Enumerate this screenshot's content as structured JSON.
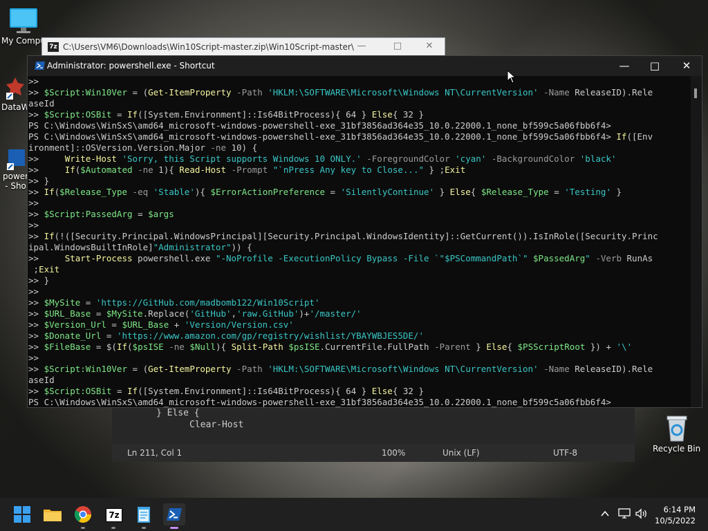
{
  "desktop": {
    "icons": [
      {
        "label": "My Compu",
        "icon": "computer-icon"
      },
      {
        "label": "DataW",
        "icon": "datawrapper-icon"
      },
      {
        "label": "power",
        "label2": "- Sho",
        "icon": "powershell-shortcut-icon"
      },
      {
        "label": "Recycle Bin",
        "icon": "recycle-bin-icon"
      }
    ]
  },
  "explorer_window": {
    "title": "C:\\Users\\VM6\\Downloads\\Win10Script-master.zip\\Win10Script-master\\"
  },
  "notepad": {
    "code_lines": [
      "} Else {",
      "Clear-Host"
    ],
    "status": {
      "position": "Ln 211, Col 1",
      "zoom": "100%",
      "line_ending": "Unix (LF)",
      "encoding": "UTF-8"
    }
  },
  "powershell": {
    "title": "Administrator: powershell.exe - Shortcut",
    "lines": [
      [
        [
          "p",
          ">>"
        ]
      ],
      [
        [
          "p",
          ">> "
        ],
        [
          "v",
          "$Script:Win10Ver"
        ],
        [
          "p",
          " = ("
        ],
        [
          "c",
          "Get-ItemProperty"
        ],
        [
          "m",
          " -Path "
        ],
        [
          "s",
          "'HKLM:\\SOFTWARE\\Microsoft\\Windows NT\\CurrentVersion'"
        ],
        [
          "m",
          " -Name "
        ],
        [
          "p",
          "ReleaseID).Rele"
        ]
      ],
      [
        [
          "p",
          "aseId"
        ]
      ],
      [
        [
          "p",
          ">> "
        ],
        [
          "v",
          "$Script:OSBit"
        ],
        [
          "p",
          " = "
        ],
        [
          "c",
          "If"
        ],
        [
          "p",
          "([System.Environment]::Is64BitProcess){ 64 } "
        ],
        [
          "c",
          "Else"
        ],
        [
          "p",
          "{ 32 }"
        ]
      ],
      [
        [
          "p",
          "PS C:\\Windows\\WinSxS\\amd64_microsoft-windows-powershell-exe_31bf3856ad364e35_10.0.22000.1_none_bf599c5a06fbb6f4>"
        ]
      ],
      [
        [
          "p",
          "PS C:\\Windows\\WinSxS\\amd64_microsoft-windows-powershell-exe_31bf3856ad364e35_10.0.22000.1_none_bf599c5a06fbb6f4> "
        ],
        [
          "c",
          "If"
        ],
        [
          "p",
          "([Env"
        ]
      ],
      [
        [
          "p",
          "ironment]::OSVersion.Version.Major "
        ],
        [
          "m",
          "-ne"
        ],
        [
          "p",
          " 10) {"
        ]
      ],
      [
        [
          "p",
          ">>     "
        ],
        [
          "c",
          "Write-Host"
        ],
        [
          "s",
          " 'Sorry, this Script supports Windows 10 ONLY.'"
        ],
        [
          "m",
          " -ForegroundColor "
        ],
        [
          "s",
          "'cyan'"
        ],
        [
          "m",
          " -BackgroundColor "
        ],
        [
          "s",
          "'black'"
        ]
      ],
      [
        [
          "p",
          ">>     "
        ],
        [
          "c",
          "If"
        ],
        [
          "p",
          "("
        ],
        [
          "v",
          "$Automated"
        ],
        [
          "m",
          " -ne"
        ],
        [
          "p",
          " 1){ "
        ],
        [
          "c",
          "Read-Host"
        ],
        [
          "m",
          " -Prompt "
        ],
        [
          "s",
          "\"`nPress Any key to Close...\""
        ],
        [
          "p",
          " } ;"
        ],
        [
          "c",
          "Exit"
        ]
      ],
      [
        [
          "p",
          ">> }"
        ]
      ],
      [
        [
          "p",
          ">> "
        ],
        [
          "c",
          "If"
        ],
        [
          "p",
          "("
        ],
        [
          "v",
          "$Release_Type"
        ],
        [
          "m",
          " -eq "
        ],
        [
          "s",
          "'Stable'"
        ],
        [
          "p",
          "){ "
        ],
        [
          "v",
          "$ErrorActionPreference"
        ],
        [
          "p",
          " = "
        ],
        [
          "s",
          "'SilentlyContinue'"
        ],
        [
          "p",
          " } "
        ],
        [
          "c",
          "Else"
        ],
        [
          "p",
          "{ "
        ],
        [
          "v",
          "$Release_Type"
        ],
        [
          "p",
          " = "
        ],
        [
          "s",
          "'Testing'"
        ],
        [
          "p",
          " }"
        ]
      ],
      [
        [
          "p",
          ">>"
        ]
      ],
      [
        [
          "p",
          ">> "
        ],
        [
          "v",
          "$Script:PassedArg"
        ],
        [
          "p",
          " = "
        ],
        [
          "v",
          "$args"
        ]
      ],
      [
        [
          "p",
          ">>"
        ]
      ],
      [
        [
          "p",
          ">> "
        ],
        [
          "c",
          "If"
        ],
        [
          "p",
          "(!([Security.Principal.WindowsPrincipal][Security.Principal.WindowsIdentity]::GetCurrent()).IsInRole([Security.Princ"
        ]
      ],
      [
        [
          "p",
          "ipal.WindowsBuiltInRole]"
        ],
        [
          "s",
          "\"Administrator\""
        ],
        [
          "p",
          ")) {"
        ]
      ],
      [
        [
          "p",
          ">>     "
        ],
        [
          "c",
          "Start-Process"
        ],
        [
          "p",
          " powershell.exe "
        ],
        [
          "s",
          "\"-NoProfile -ExecutionPolicy Bypass -File `\"$PSCommandPath`\" "
        ],
        [
          "v",
          "$PassedArg"
        ],
        [
          "s",
          "\""
        ],
        [
          "m",
          " -Verb "
        ],
        [
          "p",
          "RunAs"
        ]
      ],
      [
        [
          "p",
          " ;"
        ],
        [
          "c",
          "Exit"
        ]
      ],
      [
        [
          "p",
          ">> }"
        ]
      ],
      [
        [
          "p",
          ">>"
        ]
      ],
      [
        [
          "p",
          ">> "
        ],
        [
          "v",
          "$MySite"
        ],
        [
          "p",
          " = "
        ],
        [
          "s",
          "'https://GitHub.com/madbomb122/Win10Script'"
        ]
      ],
      [
        [
          "p",
          ">> "
        ],
        [
          "v",
          "$URL_Base"
        ],
        [
          "p",
          " = "
        ],
        [
          "v",
          "$MySite"
        ],
        [
          "p",
          ".Replace("
        ],
        [
          "s",
          "'GitHub'"
        ],
        [
          "p",
          ","
        ],
        [
          "s",
          "'raw.GitHub'"
        ],
        [
          "p",
          ")+"
        ],
        [
          "s",
          "'/master/'"
        ]
      ],
      [
        [
          "p",
          ">> "
        ],
        [
          "v",
          "$Version_Url"
        ],
        [
          "p",
          " = "
        ],
        [
          "v",
          "$URL_Base"
        ],
        [
          "p",
          " + "
        ],
        [
          "s",
          "'Version/Version.csv'"
        ]
      ],
      [
        [
          "p",
          ">> "
        ],
        [
          "v",
          "$Donate_Url"
        ],
        [
          "p",
          " = "
        ],
        [
          "s",
          "'https://www.amazon.com/gp/registry/wishlist/YBAYWBJES5DE/'"
        ]
      ],
      [
        [
          "p",
          ">> "
        ],
        [
          "v",
          "$FileBase"
        ],
        [
          "p",
          " = $("
        ],
        [
          "c",
          "If"
        ],
        [
          "p",
          "("
        ],
        [
          "v",
          "$psISE"
        ],
        [
          "m",
          " -ne "
        ],
        [
          "v",
          "$Null"
        ],
        [
          "p",
          "){ "
        ],
        [
          "c",
          "Split-Path"
        ],
        [
          "v",
          " $psISE"
        ],
        [
          "p",
          ".CurrentFile.FullPath"
        ],
        [
          "m",
          " -Parent"
        ],
        [
          "p",
          " } "
        ],
        [
          "c",
          "Else"
        ],
        [
          "p",
          "{ "
        ],
        [
          "v",
          "$PSScriptRoot"
        ],
        [
          "p",
          " }) + "
        ],
        [
          "s",
          "'\\'"
        ]
      ],
      [
        [
          "p",
          ">>"
        ]
      ],
      [
        [
          "p",
          ">> "
        ],
        [
          "v",
          "$Script:Win10Ver"
        ],
        [
          "p",
          " = ("
        ],
        [
          "c",
          "Get-ItemProperty"
        ],
        [
          "m",
          " -Path "
        ],
        [
          "s",
          "'HKLM:\\SOFTWARE\\Microsoft\\Windows NT\\CurrentVersion'"
        ],
        [
          "m",
          " -Name "
        ],
        [
          "p",
          "ReleaseID).Rele"
        ]
      ],
      [
        [
          "p",
          "aseId"
        ]
      ],
      [
        [
          "p",
          ">> "
        ],
        [
          "v",
          "$Script:OSBit"
        ],
        [
          "p",
          " = "
        ],
        [
          "c",
          "If"
        ],
        [
          "p",
          "([System.Environment]::Is64BitProcess){ 64 } "
        ],
        [
          "c",
          "Else"
        ],
        [
          "p",
          "{ 32 }"
        ]
      ],
      [
        [
          "p",
          "PS C:\\Windows\\WinSxS\\amd64_microsoft-windows-powershell-exe_31bf3856ad364e35_10.0.22000.1_none_bf599c5a06fbb6f4>"
        ]
      ]
    ]
  },
  "taskbar": {
    "apps": [
      {
        "name": "start-button",
        "icon": "windows-logo-icon"
      },
      {
        "name": "file-explorer",
        "icon": "folder-icon"
      },
      {
        "name": "chrome",
        "icon": "chrome-icon"
      },
      {
        "name": "7zip",
        "icon": "7zip-icon",
        "label": "7z"
      },
      {
        "name": "notepad",
        "icon": "notepad-icon"
      },
      {
        "name": "powershell",
        "icon": "powershell-icon"
      }
    ],
    "time": "6:14 PM",
    "date": "10/5/2022"
  }
}
